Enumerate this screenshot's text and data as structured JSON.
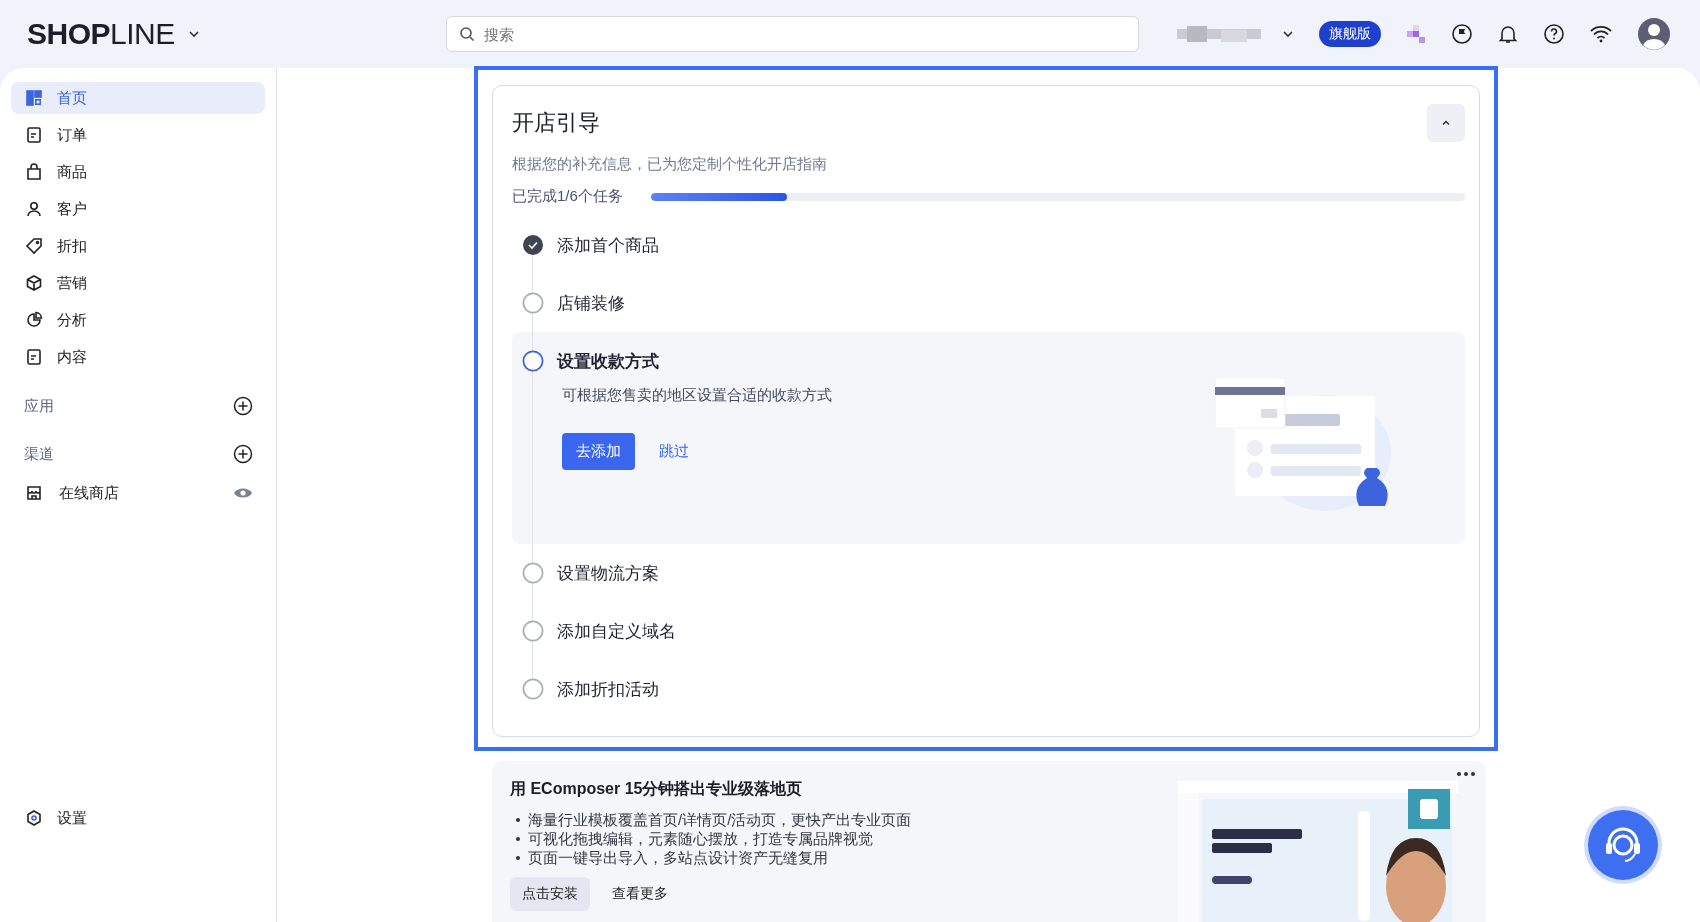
{
  "header": {
    "logo": "**SHOP**LINE",
    "search": {
      "placeholder": "搜索"
    },
    "plan_badge": "旗舰版"
  },
  "sidebar": {
    "items": [
      {
        "label": "首页",
        "selected": true
      },
      {
        "label": "订单",
        "selected": false
      },
      {
        "label": "商品",
        "selected": false
      },
      {
        "label": "客户",
        "selected": false
      },
      {
        "label": "折扣",
        "selected": false
      },
      {
        "label": "营销",
        "selected": false
      },
      {
        "label": "分析",
        "selected": false
      },
      {
        "label": "内容",
        "selected": false
      }
    ],
    "sections": [
      {
        "label": "应用"
      },
      {
        "label": "渠道",
        "items": [
          {
            "label": "在线商店"
          }
        ]
      }
    ],
    "footer_item": {
      "label": "设置"
    }
  },
  "guide": {
    "title": "开店引导",
    "subtitle": "根据您的补充信息，已为您定制个性化开店指南",
    "progress_text": "已完成1/6个任务",
    "level": 0.167,
    "steps": [
      {
        "label": "添加首个商品",
        "done": true,
        "expanded": false
      },
      {
        "label": "店铺装修",
        "done": false,
        "expanded": false
      },
      {
        "label": "设置收款方式",
        "done": false,
        "expanded": true,
        "description": "可根据您售卖的地区设置合适的收款方式",
        "primary_button": "去添加",
        "secondary_link": "跳过"
      },
      {
        "label": "设置物流方案",
        "done": false,
        "expanded": false
      },
      {
        "label": "添加自定义域名",
        "done": false,
        "expanded": false
      },
      {
        "label": "添加折扣活动",
        "done": false,
        "expanded": false
      }
    ]
  },
  "promo": {
    "title": "用 EComposer 15分钟搭出专业级落地页",
    "bullets": [
      "海量行业模板覆盖首页/详情页/活动页，更快产出专业页面",
      "可视化拖拽编辑，元素随心摆放，打造专属品牌视觉",
      "页面一键导出导入，多站点设计资产无缝复用"
    ],
    "buttons": [
      "点击安装",
      "查看更多"
    ]
  }
}
